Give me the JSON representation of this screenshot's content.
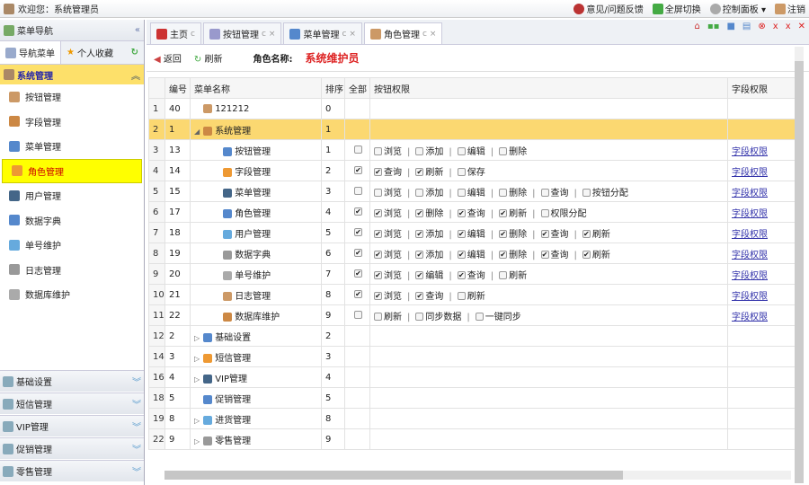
{
  "topbar": {
    "welcome": "欢迎您：",
    "user": "系统管理员",
    "links": [
      "意见/问题反馈",
      "全屏切换",
      "控制面板 ▾",
      "注销"
    ]
  },
  "sidebar": {
    "title": "菜单导航",
    "tabs": [
      "导航菜单",
      "个人收藏"
    ],
    "group": "系统管理",
    "items": [
      "按钮管理",
      "字段管理",
      "菜单管理",
      "角色管理",
      "用户管理",
      "数据字典",
      "单号维护",
      "日志管理",
      "数据库维护"
    ],
    "accordions": [
      "基础设置",
      "短信管理",
      "VIP管理",
      "促销管理",
      "零售管理"
    ]
  },
  "tabs": [
    {
      "label": "主页",
      "closable": false
    },
    {
      "label": "按钮管理",
      "closable": true
    },
    {
      "label": "菜单管理",
      "closable": true
    },
    {
      "label": "角色管理",
      "closable": true
    }
  ],
  "toolbar": {
    "back": "返回",
    "refresh": "刷新",
    "role_label": "角色名称:",
    "role_name": "系统维护员"
  },
  "columns": [
    "",
    "编号",
    "菜单名称",
    "排序",
    "全部",
    "按钮权限",
    "字段权限"
  ],
  "field_link": "字段权限",
  "rows": [
    {
      "n": "1",
      "id": "40",
      "name": "121212",
      "sort": "0",
      "lvl": 1,
      "all": null,
      "perms": [],
      "field": false
    },
    {
      "n": "2",
      "id": "1",
      "name": "系统管理",
      "sort": "1",
      "lvl": 0,
      "exp": "◢",
      "all": null,
      "perms": [],
      "field": false,
      "sel": true
    },
    {
      "n": "3",
      "id": "13",
      "name": "按钮管理",
      "sort": "1",
      "lvl": 2,
      "all": false,
      "perms": [
        [
          "浏览",
          0
        ],
        [
          "添加",
          0
        ],
        [
          "编辑",
          0
        ],
        [
          "删除",
          0
        ]
      ],
      "field": true
    },
    {
      "n": "4",
      "id": "14",
      "name": "字段管理",
      "sort": "2",
      "lvl": 2,
      "all": true,
      "perms": [
        [
          "查询",
          1
        ],
        [
          "刷新",
          1
        ],
        [
          "保存",
          0
        ]
      ],
      "field": true
    },
    {
      "n": "5",
      "id": "15",
      "name": "菜单管理",
      "sort": "3",
      "lvl": 2,
      "all": false,
      "perms": [
        [
          "浏览",
          0
        ],
        [
          "添加",
          0
        ],
        [
          "编辑",
          0
        ],
        [
          "删除",
          0
        ],
        [
          "查询",
          0
        ],
        [
          "按钮分配",
          0
        ]
      ],
      "field": true
    },
    {
      "n": "6",
      "id": "17",
      "name": "角色管理",
      "sort": "4",
      "lvl": 2,
      "all": true,
      "perms": [
        [
          "浏览",
          1
        ],
        [
          "删除",
          1
        ],
        [
          "查询",
          1
        ],
        [
          "刷新",
          1
        ],
        [
          "权限分配",
          0
        ]
      ],
      "field": true
    },
    {
      "n": "7",
      "id": "18",
      "name": "用户管理",
      "sort": "5",
      "lvl": 2,
      "all": true,
      "perms": [
        [
          "浏览",
          1
        ],
        [
          "添加",
          1
        ],
        [
          "编辑",
          1
        ],
        [
          "删除",
          1
        ],
        [
          "查询",
          1
        ],
        [
          "刷新",
          1
        ]
      ],
      "field": true
    },
    {
      "n": "8",
      "id": "19",
      "name": "数据字典",
      "sort": "6",
      "lvl": 2,
      "all": true,
      "perms": [
        [
          "浏览",
          1
        ],
        [
          "添加",
          1
        ],
        [
          "编辑",
          1
        ],
        [
          "删除",
          1
        ],
        [
          "查询",
          1
        ],
        [
          "刷新",
          1
        ]
      ],
      "field": true
    },
    {
      "n": "9",
      "id": "20",
      "name": "单号维护",
      "sort": "7",
      "lvl": 2,
      "all": true,
      "perms": [
        [
          "浏览",
          1
        ],
        [
          "编辑",
          1
        ],
        [
          "查询",
          1
        ],
        [
          "刷新",
          0
        ]
      ],
      "field": true
    },
    {
      "n": "10",
      "id": "21",
      "name": "日志管理",
      "sort": "8",
      "lvl": 2,
      "all": true,
      "perms": [
        [
          "浏览",
          1
        ],
        [
          "查询",
          1
        ],
        [
          "刷新",
          0
        ]
      ],
      "field": true
    },
    {
      "n": "11",
      "id": "22",
      "name": "数据库维护",
      "sort": "9",
      "lvl": 2,
      "all": false,
      "perms": [
        [
          "刷新",
          0
        ],
        [
          "同步数据",
          0
        ],
        [
          "一键同步",
          0
        ]
      ],
      "field": true
    },
    {
      "n": "12",
      "id": "2",
      "name": "基础设置",
      "sort": "2",
      "lvl": 0,
      "exp": "▷",
      "all": null,
      "perms": [],
      "field": false
    },
    {
      "n": "14",
      "id": "3",
      "name": "短信管理",
      "sort": "3",
      "lvl": 0,
      "exp": "▷",
      "all": null,
      "perms": [],
      "field": false
    },
    {
      "n": "16",
      "id": "4",
      "name": "VIP管理",
      "sort": "4",
      "lvl": 0,
      "exp": "▷",
      "all": null,
      "perms": [],
      "field": false
    },
    {
      "n": "18",
      "id": "5",
      "name": "促销管理",
      "sort": "5",
      "lvl": 0,
      "exp": "",
      "all": null,
      "perms": [],
      "field": false
    },
    {
      "n": "19",
      "id": "8",
      "name": "进货管理",
      "sort": "8",
      "lvl": 0,
      "exp": "▷",
      "all": null,
      "perms": [],
      "field": false
    },
    {
      "n": "22",
      "id": "9",
      "name": "零售管理",
      "sort": "9",
      "lvl": 0,
      "exp": "▷",
      "all": null,
      "perms": [],
      "field": false
    }
  ]
}
